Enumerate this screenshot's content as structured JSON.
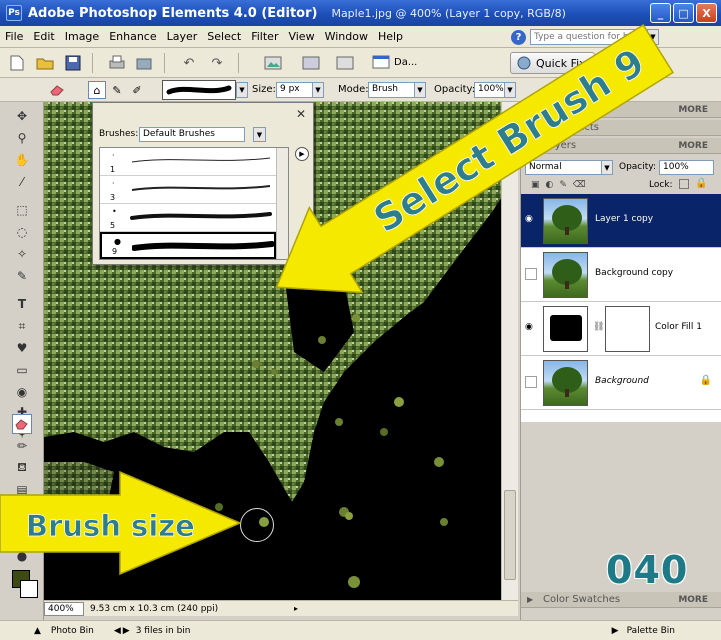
{
  "titlebar": {
    "app_icon": "Ps",
    "app": "Adobe Photoshop Elements 4.0 (Editor)",
    "doc": "Maple1.jpg @ 400% (Layer 1 copy, RGB/8)",
    "buttons": [
      "_",
      "□",
      "X"
    ]
  },
  "menu": {
    "items": [
      "File",
      "Edit",
      "Image",
      "Enhance",
      "Layer",
      "Select",
      "Filter",
      "View",
      "Window",
      "Help"
    ],
    "help_placeholder": "Type a question for help"
  },
  "shortcuts": {
    "date_label": "Da...",
    "quickfix_label": "Quick Fix"
  },
  "options": {
    "size_label": "Size:",
    "size_value": "9 px",
    "mode_label": "Mode:",
    "mode_value": "Brush",
    "opacity_label": "Opacity:",
    "opacity_value": "100%"
  },
  "brushes_popup": {
    "label": "Brushes:",
    "set": "Default Brushes",
    "rows": [
      {
        "number": "1"
      },
      {
        "number": "3"
      },
      {
        "number": "5"
      },
      {
        "number": "9"
      }
    ]
  },
  "palette": {
    "sections": [
      {
        "title": "",
        "more": "MORE"
      },
      {
        "title": "and Effects",
        "more": ""
      },
      {
        "title": "Layers",
        "more": "MORE"
      }
    ],
    "blend_mode": "Normal",
    "opacity_label": "Opacity:",
    "opacity_value": "100%",
    "lock_label": "Lock:",
    "layers": [
      {
        "name": "Layer 1 copy",
        "selected": true
      },
      {
        "name": "Background copy",
        "selected": false
      },
      {
        "name": "Color Fill 1",
        "selected": false
      },
      {
        "name": "Background",
        "selected": false
      }
    ],
    "color_swatches": "Color Swatches",
    "color_swatches_more": "MORE"
  },
  "status": {
    "zoom": "400%",
    "dimensions": "9.53 cm x 10.3 cm (240 ppi)"
  },
  "bottombar": {
    "photo_bin": "Photo Bin",
    "files_in_bin": "3 files in bin",
    "palette_bin": "Palette Bin"
  },
  "annotations": {
    "select_brush": "Select Brush 9",
    "brush_size": "Brush size",
    "page_number": "040"
  },
  "colors": {
    "accent": "#f5e900",
    "callout_text": "#2d7d8c",
    "selection": "#0a246a"
  }
}
